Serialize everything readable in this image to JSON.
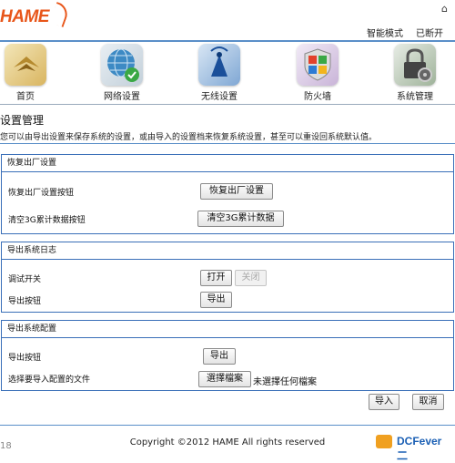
{
  "brand": {
    "logo_text": "HAME"
  },
  "header": {
    "home_icon": "home-icon",
    "mode": "智能模式",
    "status": "已断开"
  },
  "nav": [
    {
      "label": "首页",
      "icon": "home-tile-icon"
    },
    {
      "label": "网络设置",
      "icon": "globe-check-icon"
    },
    {
      "label": "无线设置",
      "icon": "wireless-signal-icon"
    },
    {
      "label": "防火墙",
      "icon": "windows-shield-icon"
    },
    {
      "label": "系统管理",
      "icon": "padlock-gear-icon"
    }
  ],
  "page": {
    "title": "设置管理",
    "description": "您可以由导出设置来保存系统的设置，或由导入的设置档来恢复系统设置，甚至可以重设回系统默认值。"
  },
  "sections": {
    "factory": {
      "title": "恢复出厂设置",
      "restore_label": "恢复出厂设置按钮",
      "restore_button": "恢复出厂设置",
      "clear_label": "清空3G累计数据按钮",
      "clear_button": "清空3G累计数据"
    },
    "log": {
      "title": "导出系统日志",
      "debug_label": "调试开关",
      "on_button": "打开",
      "off_button": "关闭",
      "export_label": "导出按钮",
      "export_button": "导出"
    },
    "config": {
      "title": "导出系统配置",
      "export_label": "导出按钮",
      "export_button": "导出",
      "import_label": "选择要导入配置的文件",
      "choose_button": "選擇檔案",
      "file_status": "未選擇任何檔案"
    }
  },
  "actions": {
    "import_button": "导入",
    "cancel_button": "取消"
  },
  "footer": {
    "copyright": "Copyright ©2012 HAME All rights reserved",
    "watermark": "DCFever 二",
    "left_number": "18"
  }
}
